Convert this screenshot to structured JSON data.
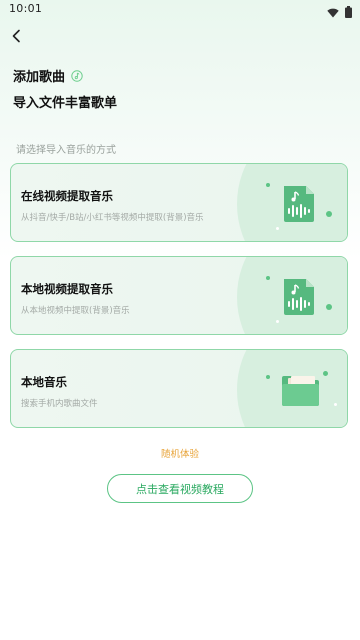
{
  "status_bar": {
    "time": "10:01"
  },
  "header": {
    "title": "添加歌曲",
    "subtitle": "导入文件丰富歌单"
  },
  "section_label": "请选择导入音乐的方式",
  "options": [
    {
      "title": "在线视频提取音乐",
      "desc": "从抖音/快手/B站/小红书等视频中提取(背景)音乐",
      "icon": "music-file-waveform-icon"
    },
    {
      "title": "本地视频提取音乐",
      "desc": "从本地视频中提取(背景)音乐",
      "icon": "music-file-waveform-icon"
    },
    {
      "title": "本地音乐",
      "desc": "搜索手机内歌曲文件",
      "icon": "folder-icon"
    }
  ],
  "random_link": "随机体验",
  "tutorial_button": "点击查看视频教程",
  "colors": {
    "accent": "#5cc485",
    "link": "#e8a43a",
    "card_border": "#8fd7a8"
  }
}
